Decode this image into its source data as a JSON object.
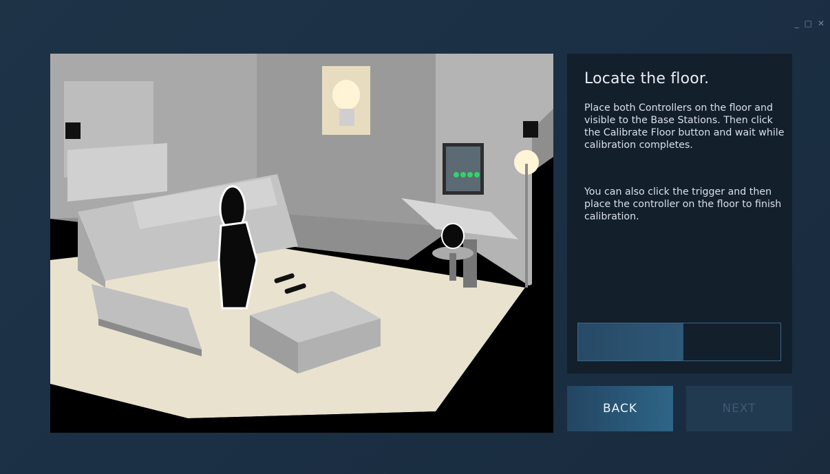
{
  "window": {
    "minimize_icon": "minimize-icon",
    "maximize_icon": "maximize-icon",
    "close_icon": "close-icon",
    "minimize_glyph": "_",
    "maximize_glyph": "□",
    "close_glyph": "✕"
  },
  "instructions": {
    "title": "Locate the floor.",
    "paragraph1": "Place both Controllers on the floor and visible to the Base Stations. Then click the Calibrate Floor button and wait while calibration completes.",
    "paragraph2": "You can also click the trigger and then place the controller on the floor to finish calibration."
  },
  "calibration_progress": {
    "fraction": 0.52
  },
  "navigation": {
    "back_label": "BACK",
    "next_label": "NEXT",
    "next_enabled": false
  },
  "colors": {
    "background": "#1c3044",
    "panel": "#141f2c",
    "progress_fill": "#2b5372",
    "back_button": "#2b5a7a",
    "next_button_disabled": "#223a50"
  }
}
